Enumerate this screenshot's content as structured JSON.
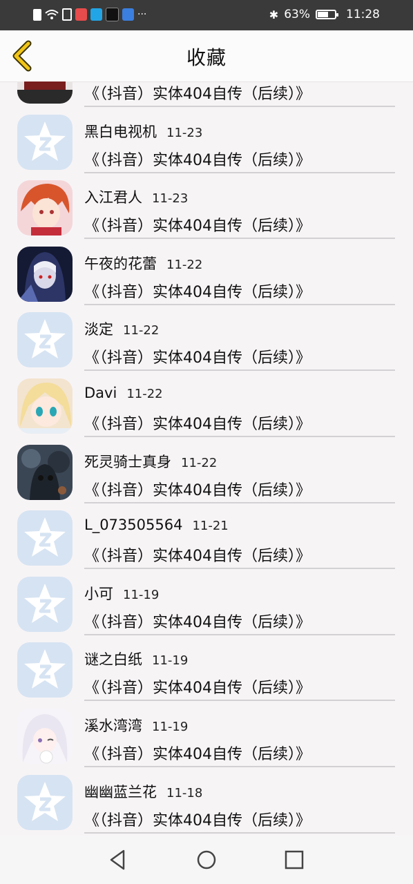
{
  "status_bar": {
    "battery": "63%",
    "battery_level": 0.63,
    "time": "11:28",
    "more": "···"
  },
  "header": {
    "title": "收藏"
  },
  "colors": {
    "accent": "#f0c419",
    "default_avatar": "#d6e3f2"
  },
  "list": {
    "items": [
      {
        "name": "",
        "date": "",
        "text": "《（抖音）实体404自传（后续）》",
        "avatar": "minecraft-avatar"
      },
      {
        "name": "黑白电视机",
        "date": "11-23",
        "text": "《（抖音）实体404自传（后续）》",
        "avatar": "default-qzone-avatar"
      },
      {
        "name": "入江君人",
        "date": "11-23",
        "text": "《（抖音）实体404自传（后续）》",
        "avatar": "anime-red-hair-avatar"
      },
      {
        "name": "午夜的花蕾",
        "date": "11-22",
        "text": "《（抖音）实体404自传（后续）》",
        "avatar": "anime-dark-nun-avatar"
      },
      {
        "name": "淡定",
        "date": "11-22",
        "text": "《（抖音）实体404自传（后续）》",
        "avatar": "default-qzone-avatar"
      },
      {
        "name": "Davi",
        "date": "11-22",
        "text": "《（抖音）实体404自传（后续）》",
        "avatar": "anime-blonde-girl-avatar"
      },
      {
        "name": "死灵骑士真身",
        "date": "11-22",
        "text": "《（抖音）实体404自传（后续）》",
        "avatar": "dark-knight-avatar"
      },
      {
        "name": "L_073505564",
        "date": "11-21",
        "text": "《（抖音）实体404自传（后续）》",
        "avatar": "default-qzone-avatar"
      },
      {
        "name": "小可",
        "date": "11-19",
        "text": "《（抖音）实体404自传（后续）》",
        "avatar": "default-qzone-avatar"
      },
      {
        "name": "谜之白纸",
        "date": "11-19",
        "text": "《（抖音）实体404自传（后续）》",
        "avatar": "default-qzone-avatar"
      },
      {
        "name": "溪水湾湾",
        "date": "11-19",
        "text": "《（抖音）实体404自传（后续）》",
        "avatar": "anime-white-hair-avatar"
      },
      {
        "name": "幽幽蓝兰花",
        "date": "11-18",
        "text": "《（抖音）实体404自传（后续）》",
        "avatar": "default-qzone-avatar"
      }
    ]
  },
  "nav": {
    "back": "back-triangle-icon",
    "home": "home-circle-icon",
    "recents": "recents-square-icon"
  }
}
